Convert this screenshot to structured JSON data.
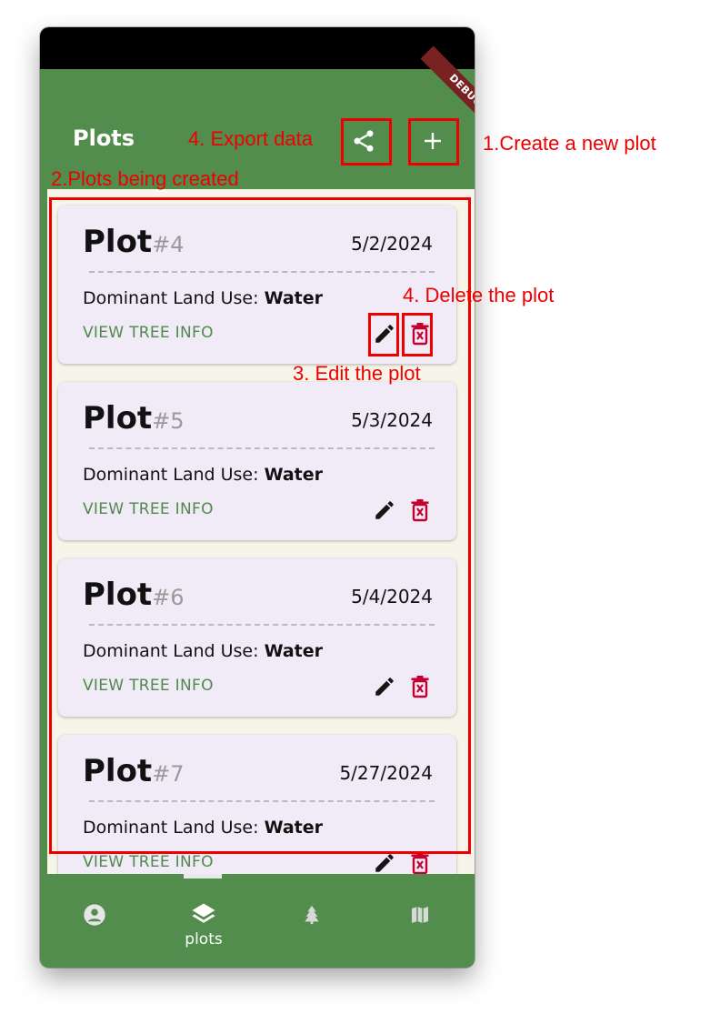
{
  "app_bar": {
    "title": "Plots",
    "share_icon": "share-icon",
    "add_icon": "add-icon",
    "debug_banner": "DEBUG",
    "background": "#528d4d"
  },
  "plots": [
    {
      "label": "Plot",
      "number": "#4",
      "date": "5/2/2024",
      "land_use_label": "Dominant Land Use: ",
      "land_use_value": "Water",
      "view_label": "VIEW TREE INFO"
    },
    {
      "label": "Plot",
      "number": "#5",
      "date": "5/3/2024",
      "land_use_label": "Dominant Land Use: ",
      "land_use_value": "Water",
      "view_label": "VIEW TREE INFO"
    },
    {
      "label": "Plot",
      "number": "#6",
      "date": "5/4/2024",
      "land_use_label": "Dominant Land Use: ",
      "land_use_value": "Water",
      "view_label": "VIEW TREE INFO"
    },
    {
      "label": "Plot",
      "number": "#7",
      "date": "5/27/2024",
      "land_use_label": "Dominant Land Use: ",
      "land_use_value": "Water",
      "view_label": "VIEW TREE INFO"
    }
  ],
  "bottom_nav": {
    "items": [
      {
        "icon": "account-icon",
        "label": ""
      },
      {
        "icon": "layers-icon",
        "label": "plots",
        "selected": true
      },
      {
        "icon": "tree-icon",
        "label": ""
      },
      {
        "icon": "map-icon",
        "label": ""
      }
    ]
  },
  "annotations": {
    "export": "4. Export data",
    "create": "1.Create a new plot",
    "plots_created": "2.Plots being created",
    "delete": "4. Delete the plot",
    "edit": "3. Edit the plot",
    "color": "#ee0000"
  },
  "colors": {
    "card_bg": "#f1eaf7",
    "link_green": "#4f8a4a",
    "delete_red": "#c3002f"
  }
}
